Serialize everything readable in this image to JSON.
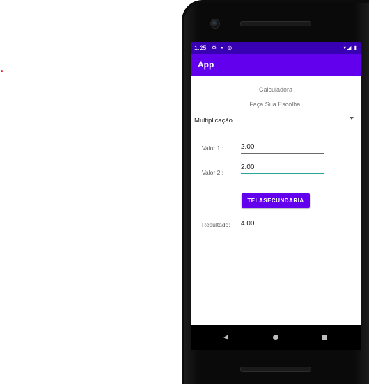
{
  "status_bar": {
    "time": "1:25",
    "left_icons": "⚙ ▪ ◎",
    "right_icons": "▾◢ ▮"
  },
  "app_bar": {
    "title": "App"
  },
  "main": {
    "heading": "Calculadora",
    "prompt": "Faça Sua Escolha:",
    "operation_selected": "Multiplicação",
    "value1_label": "Valor 1 :",
    "value1": "2.00",
    "value2_label": "Valor 2 :",
    "value2": "2.00",
    "button_label": "TELASECUNDARIA",
    "result_label": "Resultado:",
    "result_value": "4.00"
  },
  "colors": {
    "primary": "#6200ee",
    "primary_dark": "#3700b3",
    "accent": "#26a69a"
  },
  "nav_icons": [
    "back-icon",
    "home-icon",
    "recents-icon"
  ]
}
